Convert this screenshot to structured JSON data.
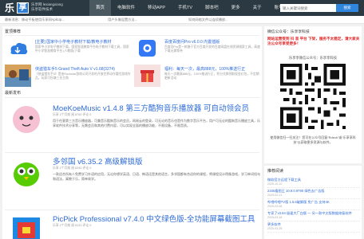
{
  "header": {
    "logo_char": "乐",
    "logo_badge": "享",
    "logo_sub": "乐享网 lexiangxiang 乐享软件技术",
    "nav": [
      "首页",
      "电脑软件",
      "移动APP",
      "手机TV",
      "脚本吧",
      "更多",
      "关于",
      "账号",
      "投稿"
    ],
    "search_placeholder": "输入关键词搜索",
    "search_button": "搜索"
  },
  "ticker": {
    "left": "最新消息：移动平板使用乐享网ApkUp...",
    "mid": "用户头像设置方法...",
    "right": "如何网络文件以连续播放..."
  },
  "recommend": {
    "title": "置顶推荐",
    "items": [
      {
        "title": "[主要] 国家中小学电子教材下载/教电子教材",
        "desc": "国家中小学电子教材下载，国家智慧教育平台电子教材下载工具，国家中小学智慧教育平台 (人教版)下载"
      },
      {
        "title": "百度百度问Pro v6.0.0 内置插版",
        "desc": "百度问Pro是一款基于官方百度开发的百度网盘在线资源搜索工具，高速下载无需等待"
      },
      {
        "title": "侠盗猎车手5 Grand Theft Auto V v1.68(3274)",
        "desc": "《侠盗猎车手5》是由Rockstar游戏公司开发的开放世界动作冒险游戏作品，玩家可扮演三名主角"
      },
      {
        "title": "福利：每天一次，最高888元，100%推送行正",
        "desc": "每天一次最高888元，100%推送行正，积分兑换领取现金红包，不定期更新活动"
      }
    ]
  },
  "latest": {
    "title": "最新发布",
    "posts": [
      {
        "title": "MoeKoeMusic v1.4.8 第三方酷狗音乐播放器 可自动领会员",
        "meta": "乐享  2个月前  阅 8760  评论 0",
        "desc": "用于任意第三方音乐播放器，可兼音乐酷狗音乐的会员，网易云的登录，可无论的音乐也是作为数字音乐平台，用户可无论的酷狗音乐播放工具，乐享软件技术分享等，无需会员和其他付费内容，可以实现全面的播放功能，不限设备，不限音质。"
      },
      {
        "title": "多邻国 v6.35.2 高级解锁版",
        "meta": "乐享  2个月前  阅 6240  评论 0",
        "desc": "一款适合所有人免费学习外语的应用，无论你想学英语、日语、韩语还是其他语言，多邻国都有合适你的课程，将课程设计得像游戏，学习单词短句和语法，寓教于乐，简单易学。"
      },
      {
        "title": "PicPick Professional v7.4.0 中文绿色版-全功能屏幕截图工具",
        "meta": "乐享  2个月前  阅 5120  评论 0",
        "desc": "PicPick是一款全功能屏幕截图工具，包含截取屏幕、图片编辑、颜色选择器、调色板、像素标尺等功能。"
      }
    ]
  },
  "sidebar": {
    "wx_title": "微信公众号：乐享享科技",
    "wx_red": "网站运营受到 抖 音 平台 下架，服务不太稳定，请大家关注公众号享受更多！",
    "wx_qr_label": "乐享享微信公众号：乐享享科技",
    "wx_note": "使用微信扫一扫关注！您可在公众号回复“Rdeck”或“乐享享科技”以获取更多资源与软件。",
    "hot_title": "推荐阅读",
    "hot": [
      {
        "t": "微软官方远程下载工具",
        "d": "2025-10-10"
      },
      {
        "t": "2345看图王 10.9.0.9790 绿色去广告版",
        "d": "2025-02-21"
      },
      {
        "t": "哔哩哔哩TV版 1.6.6破解版 免广告 支持4K",
        "d": "2025-03-08"
      },
      {
        "t": "专家了v3.84 极速大厂白版 — 另一款中文版数据修复软件",
        "d": "2025-03-18"
      },
      {
        "t": "更多软件",
        "d": "2025-03-26"
      }
    ]
  },
  "colors": {
    "header": "#2b3a42",
    "accent": "#2e6bd6",
    "red": "#e02424"
  }
}
